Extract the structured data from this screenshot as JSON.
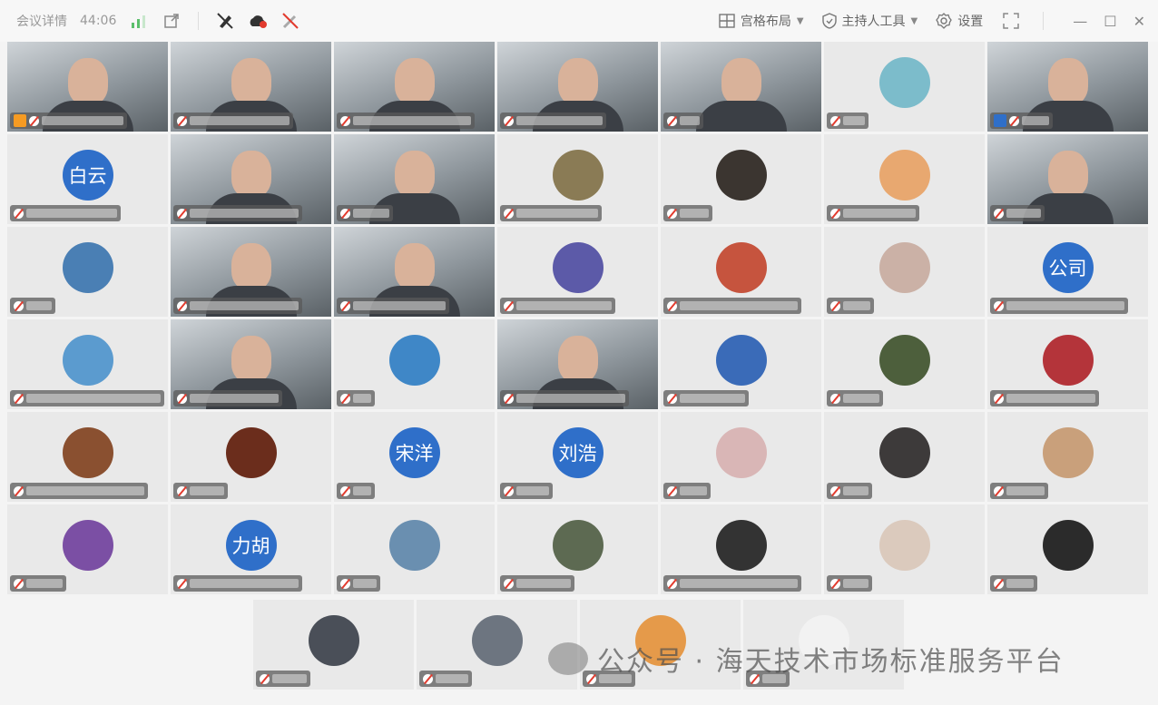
{
  "titlebar": {
    "meeting_details": "会议详情",
    "timer": "44:06",
    "grid_layout": "宫格布局",
    "host_tools": "主持人工具",
    "settings": "设置"
  },
  "tiles": [
    [
      {
        "kind": "video",
        "host": "orange",
        "mic": "on",
        "bar": 110
      },
      {
        "kind": "video",
        "bar": 130
      },
      {
        "kind": "video",
        "bar": 150
      },
      {
        "kind": "video",
        "bar": 115
      },
      {
        "kind": "video",
        "bar": 42
      },
      {
        "kind": "avatar",
        "color": "#7cbccb",
        "bar": 44
      },
      {
        "kind": "video",
        "host": "blue",
        "bar": 50
      }
    ],
    [
      {
        "kind": "text",
        "label": "白云",
        "bar": 120
      },
      {
        "kind": "video",
        "bar": 140
      },
      {
        "kind": "video",
        "bar": 60
      },
      {
        "kind": "avatar",
        "color": "#8a7b55",
        "bar": 110
      },
      {
        "kind": "avatar",
        "color": "#3b3530",
        "bar": 52
      },
      {
        "kind": "avatar",
        "color": "#e8a870",
        "bar": 100
      },
      {
        "kind": "video",
        "bar": 58
      }
    ],
    [
      {
        "kind": "avatar",
        "color": "#4a7fb4",
        "bar": 48
      },
      {
        "kind": "video",
        "bar": 140
      },
      {
        "kind": "video",
        "bar": 122
      },
      {
        "kind": "avatar",
        "color": "#5c5aa8",
        "bar": 125
      },
      {
        "kind": "avatar",
        "color": "#c6543e",
        "bar": 150
      },
      {
        "kind": "avatar",
        "color": "#cbb1a6",
        "bar": 50
      },
      {
        "kind": "text",
        "label": "公司",
        "bar": 150
      }
    ],
    [
      {
        "kind": "avatar",
        "color": "#5b9bcf",
        "bar": 168
      },
      {
        "kind": "video",
        "bar": 118
      },
      {
        "kind": "avatar",
        "color": "#3f87c7",
        "bar": 34
      },
      {
        "kind": "video",
        "bar": 140
      },
      {
        "kind": "avatar",
        "color": "#3a6bb8",
        "bar": 92
      },
      {
        "kind": "avatar",
        "color": "#4d5f3c",
        "bar": 60
      },
      {
        "kind": "avatar",
        "color": "#b4343a",
        "bar": 118
      }
    ],
    [
      {
        "kind": "avatar",
        "color": "#8a5030",
        "bar": 150
      },
      {
        "kind": "avatar",
        "color": "#6b2d1c",
        "bar": 58
      },
      {
        "kind": "text",
        "label": "宋洋",
        "bar": 30
      },
      {
        "kind": "text",
        "label": "刘浩",
        "bar": 56
      },
      {
        "kind": "avatar",
        "color": "#d9b6b6",
        "bar": 50
      },
      {
        "kind": "avatar",
        "color": "#3d3a3a",
        "bar": 48
      },
      {
        "kind": "avatar",
        "color": "#c9a07b",
        "bar": 62
      }
    ],
    [
      {
        "kind": "avatar",
        "color": "#7b4fa4",
        "bar": 60
      },
      {
        "kind": "text",
        "label": "力胡",
        "bar": 140
      },
      {
        "kind": "avatar",
        "color": "#6a8fb0",
        "bar": 46
      },
      {
        "kind": "avatar",
        "color": "#5d6a52",
        "bar": 80
      },
      {
        "kind": "avatar",
        "color": "#333333",
        "bar": 150
      },
      {
        "kind": "avatar",
        "color": "#dbcabd",
        "bar": 48
      },
      {
        "kind": "avatar",
        "color": "#2b2b2b",
        "bar": 50
      }
    ]
  ],
  "last_row": [
    {
      "kind": "avatar",
      "color": "#4a4f58",
      "bar": 58
    },
    {
      "kind": "avatar",
      "color": "#6d7580",
      "bar": 56
    },
    {
      "kind": "avatar",
      "color": "#e59a4a",
      "bar": 56
    },
    {
      "kind": "avatar",
      "color": "#f2f2f2",
      "bar": 46
    }
  ],
  "watermark": "公众号 · 海天技术市场标准服务平台"
}
